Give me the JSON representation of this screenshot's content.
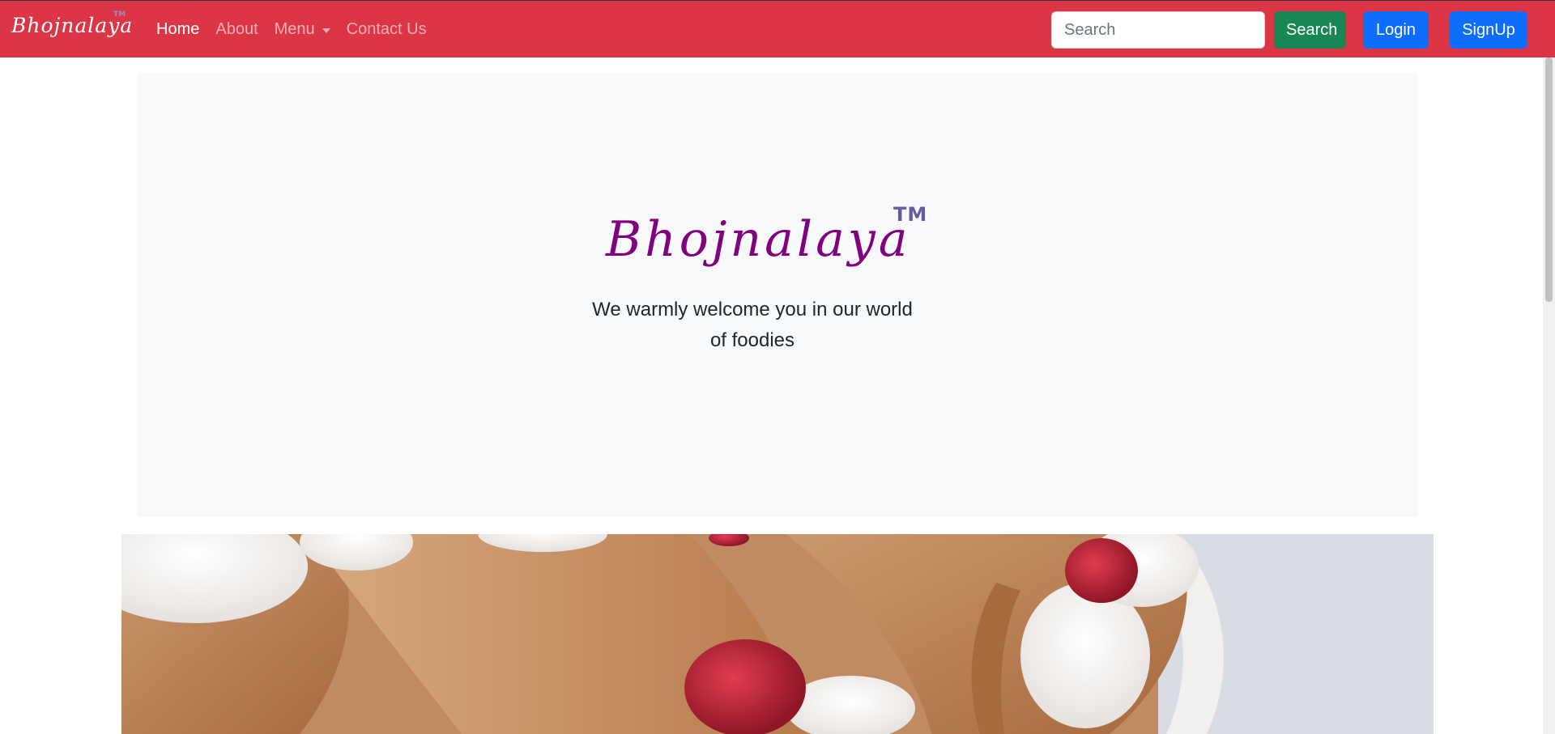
{
  "navbar": {
    "brand": "Bhojnalaya",
    "brand_tm": "TM",
    "links": [
      {
        "label": "Home",
        "active": true
      },
      {
        "label": "About",
        "active": false
      },
      {
        "label": "Menu",
        "active": false,
        "dropdown": true
      },
      {
        "label": "Contact Us",
        "active": false
      }
    ],
    "search_placeholder": "Search",
    "search_button": "Search",
    "login_button": "Login",
    "signup_button": "SignUp"
  },
  "hero": {
    "title": "Bhojnalaya",
    "tm": "TM",
    "text": "We warmly welcome you in our world of foodies"
  },
  "colors": {
    "navbar_bg": "#dc3545",
    "hero_title": "#800080",
    "search_button": "#198754",
    "primary_button": "#0d6efd",
    "jumbotron_bg": "#f8f9fa"
  }
}
